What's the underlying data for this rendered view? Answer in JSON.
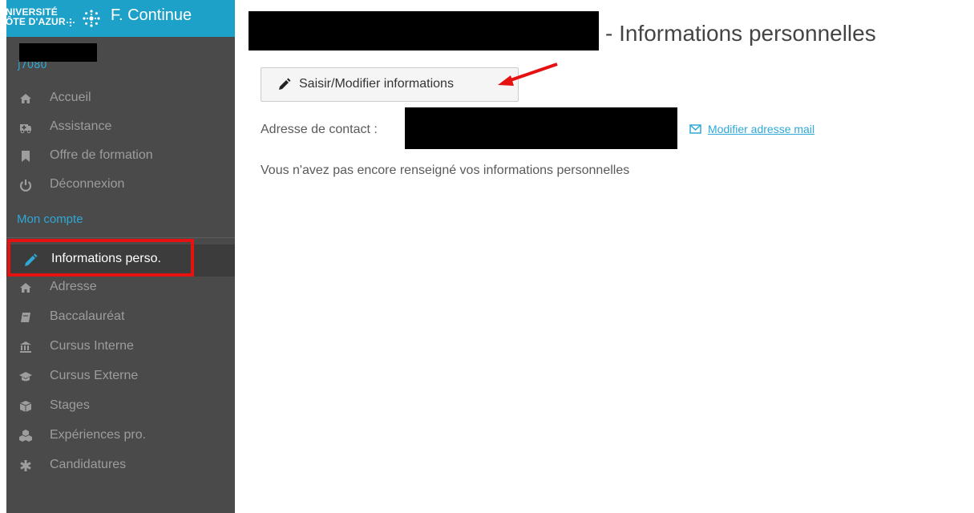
{
  "brand": {
    "univ_line1": "UNIVERSITÉ",
    "univ_line2": "CÔTE D'AZUR",
    "title": "F. Continue",
    "color": "#1ea1c9"
  },
  "user": {
    "id_partial": "j7080"
  },
  "nav": {
    "items": [
      {
        "label": "Accueil",
        "icon": "home-icon"
      },
      {
        "label": "Assistance",
        "icon": "ambulance-icon"
      },
      {
        "label": "Offre de formation",
        "icon": "bookmark-icon"
      },
      {
        "label": "Déconnexion",
        "icon": "power-icon"
      }
    ],
    "section_label": "Mon compte",
    "account_items": [
      {
        "label": "Informations perso.",
        "icon": "pencil-icon",
        "active": true
      },
      {
        "label": "Adresse",
        "icon": "home-icon"
      },
      {
        "label": "Baccalauréat",
        "icon": "book-icon"
      },
      {
        "label": "Cursus Interne",
        "icon": "institution-icon"
      },
      {
        "label": "Cursus Externe",
        "icon": "graduation-cap-icon"
      },
      {
        "label": "Stages",
        "icon": "cube-icon"
      },
      {
        "label": "Expériences pro.",
        "icon": "cubes-icon"
      },
      {
        "label": "Candidatures",
        "icon": "asterisk-icon"
      }
    ]
  },
  "main": {
    "title": "- Informations personnelles",
    "edit_button": "Saisir/Modifier informations",
    "contact_label": "Adresse de contact :",
    "modify_email_link": "Modifier adresse mail",
    "info_message": "Vous n'avez pas encore renseigné vos informations personnelles"
  },
  "colors": {
    "sidebar_bg": "#4a4a4a",
    "accent": "#2ea8d6",
    "highlight": "#e61111"
  }
}
